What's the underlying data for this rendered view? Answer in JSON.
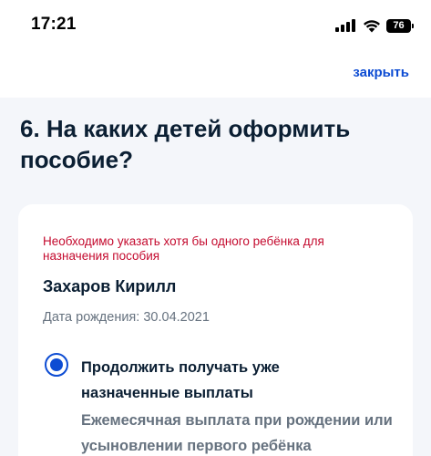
{
  "status_bar": {
    "time": "17:21",
    "battery": "76",
    "icons": [
      "signal-icon",
      "wifi-icon",
      "battery-icon"
    ]
  },
  "header": {
    "close_label": "закрыть"
  },
  "page": {
    "title": "6. На каких детей оформить пособие?"
  },
  "card": {
    "error": "Необходимо указать хотя бы одного ребёнка для назначения пособия",
    "child_name": "Захаров Кирилл",
    "birth_label": "Дата рождения:",
    "birth_date": "30.04.2021",
    "option": {
      "selected": true,
      "label": "Продолжить получать уже назначенные выплаты",
      "description": "Ежемесячная выплата при рождении или усыновлении первого ребёнка"
    }
  },
  "colors": {
    "accent": "#0d4cd3",
    "error": "#c40a2e",
    "text": "#0b1f33",
    "muted": "#66727f",
    "background": "#f4f6fa"
  }
}
